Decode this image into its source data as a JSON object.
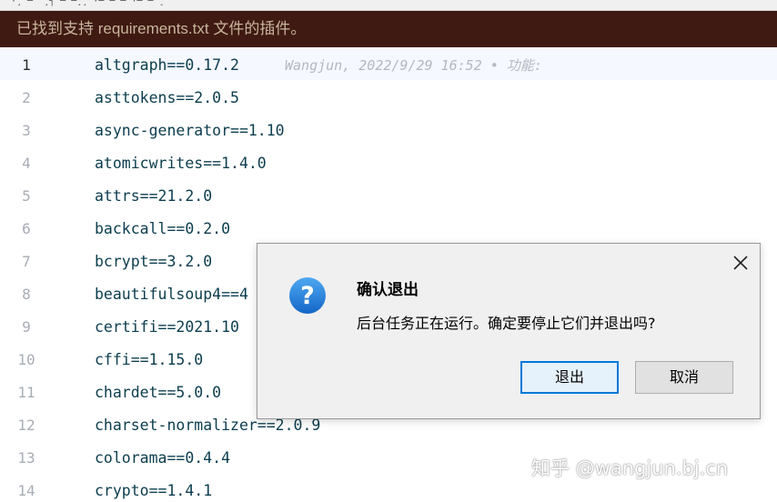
{
  "banner": {
    "text": "已找到支持 requirements.txt 文件的插件。",
    "bg": "#3f1a12",
    "fg": "#c9b59c"
  },
  "editor": {
    "lines": [
      {
        "num": "1",
        "code": "altgraph==0.17.2",
        "blame": "Wangjun, 2022/9/29 16:52 • 功能:"
      },
      {
        "num": "2",
        "code": "asttokens==2.0.5"
      },
      {
        "num": "3",
        "code": "async-generator==1.10"
      },
      {
        "num": "4",
        "code": "atomicwrites==1.4.0"
      },
      {
        "num": "5",
        "code": "attrs==21.2.0"
      },
      {
        "num": "6",
        "code": "backcall==0.2.0"
      },
      {
        "num": "7",
        "code": "bcrypt==3.2.0"
      },
      {
        "num": "8",
        "code": "beautifulsoup4==4"
      },
      {
        "num": "9",
        "code": "certifi==2021.10"
      },
      {
        "num": "10",
        "code": "cffi==1.15.0"
      },
      {
        "num": "11",
        "code": "chardet==5.0.0"
      },
      {
        "num": "12",
        "code": "charset-normalizer==2.0.9"
      },
      {
        "num": "13",
        "code": "colorama==0.4.4"
      },
      {
        "num": "14",
        "code": "crypto==1.4.1"
      }
    ]
  },
  "dialog": {
    "title": "确认退出",
    "message": "后台任务正在运行。确定要停止它们并退出吗?",
    "exit_label": "退出",
    "cancel_label": "取消",
    "icon": "question-icon",
    "accent": "#0078d7"
  },
  "watermark": {
    "text": "知乎 @wangjun.bj.cn"
  }
}
